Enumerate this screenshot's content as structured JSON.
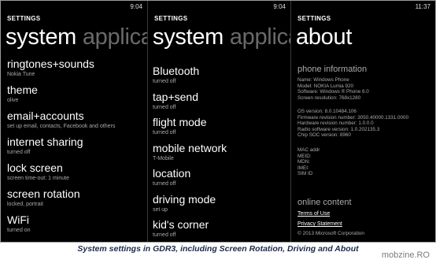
{
  "panels": [
    {
      "time": "9:04",
      "header": "SETTINGS",
      "pivot_active": "system",
      "pivot_next": "applica",
      "items": [
        {
          "title": "ringtones+sounds",
          "sub": "Nokia Tune"
        },
        {
          "title": "theme",
          "sub": "olive"
        },
        {
          "title": "email+accounts",
          "sub": "set up email, contacts, Facebook and others"
        },
        {
          "title": "internet sharing",
          "sub": "turned off"
        },
        {
          "title": "lock screen",
          "sub": "screen time-out: 1 minute"
        },
        {
          "title": "screen rotation",
          "sub": "locked, portrait"
        },
        {
          "title": "WiFi",
          "sub": "turned on"
        }
      ]
    },
    {
      "time": "9:04",
      "header": "SETTINGS",
      "pivot_active": "system",
      "pivot_next": "applica",
      "items": [
        {
          "title": "Bluetooth",
          "sub": "turned off"
        },
        {
          "title": "tap+send",
          "sub": "turned off"
        },
        {
          "title": "flight mode",
          "sub": "turned off"
        },
        {
          "title": "mobile network",
          "sub": "T-Mobile"
        },
        {
          "title": "location",
          "sub": "turned off"
        },
        {
          "title": "driving mode",
          "sub": "set up"
        },
        {
          "title": "kid's corner",
          "sub": "turned off"
        }
      ]
    },
    {
      "time": "11:37",
      "header": "SETTINGS",
      "pivot_active": "about",
      "phone_info_title": "phone information",
      "phone_info_lines": [
        "Name: Windows Phone",
        "Model: NOKIA Lumia 920",
        "Software: Windows ® Phone 8.0",
        "Screen resolution: 768x1280"
      ],
      "os_lines": [
        "OS version: 8.0.10484.106",
        "Firmware revision number: 3050.40000.1331.0000",
        "Hardware revision number: 1.0.0.0",
        "Radio software version: 1.0.202135.3",
        "Chip SOC version: 8960"
      ],
      "id_lines": [
        "MAC addr",
        "MEID:",
        "MDN:",
        "IMEI:",
        "SIM ID"
      ],
      "online_title": "online content",
      "links": [
        "Terms of Use",
        "Privacy Statement"
      ],
      "copyright": "© 2013 Microsoft Corporation"
    }
  ],
  "caption": "System settings in GDR3, including Screen Rotation, Driving and About",
  "watermark": "mobzine.RO"
}
